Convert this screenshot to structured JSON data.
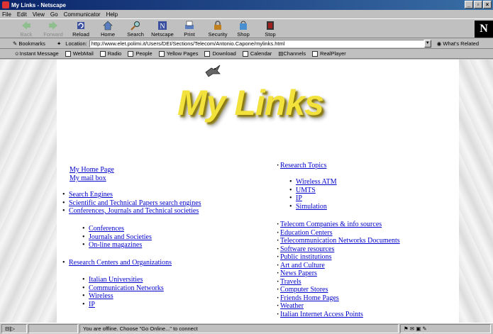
{
  "window": {
    "title": "My Links - Netscape",
    "controls": [
      "_",
      "▫",
      "×"
    ]
  },
  "menu": [
    "File",
    "Edit",
    "View",
    "Go",
    "Communicator",
    "Help"
  ],
  "toolbar": {
    "back": "Back",
    "forward": "Forward",
    "reload": "Reload",
    "home": "Home",
    "search": "Search",
    "netscape": "Netscape",
    "print": "Print",
    "security": "Security",
    "shop": "Shop",
    "stop": "Stop",
    "logo": "N"
  },
  "location": {
    "bookmarks": "Bookmarks",
    "label": "Location:",
    "url": "http://www.elet.polimi.it/Users/DEI/Sections/Telecom/Antonio.Capone/mylinks.html",
    "whats_related": "What's Related"
  },
  "personal": [
    "Instant Message",
    "WebMail",
    "Radio",
    "People",
    "Yellow Pages",
    "Download",
    "Calendar",
    "Channels",
    "RealPlayer"
  ],
  "page": {
    "heading": "My Links",
    "home": "My Home Page",
    "mail": "My mail box",
    "left_main": [
      "Search Engines",
      "Scientific and Technical Papers search engines",
      "Conferences, Journals and Technical societies"
    ],
    "conf_sub": [
      "Conferences",
      "Journals and Societies",
      "On-line magazines"
    ],
    "research_centers": "Research Centers and Organizations",
    "rc_sub": [
      "Italian Universities",
      "Communication Networks",
      "Wireless",
      "IP"
    ],
    "topics": "Research Topics",
    "topics_sub": [
      "Wireless ATM",
      "UMTS",
      "IP",
      "Simulation"
    ],
    "right_list": [
      "Telecom Companies & info sources",
      "Education Centers",
      "Telecommunication Networks Documents",
      "Software resources",
      "Public institutions",
      "Art and Culture",
      "News Papers",
      "Travels",
      "Computer Stores",
      "Friends Home Pages",
      "Weather",
      "Italian Internet Access Points"
    ]
  },
  "status": {
    "message": "You are offline. Choose \"Go Online...\" to connect"
  },
  "colors": {
    "link": "#0000cc",
    "title_bar": "#0a246a",
    "heading": "#f2e23b"
  }
}
